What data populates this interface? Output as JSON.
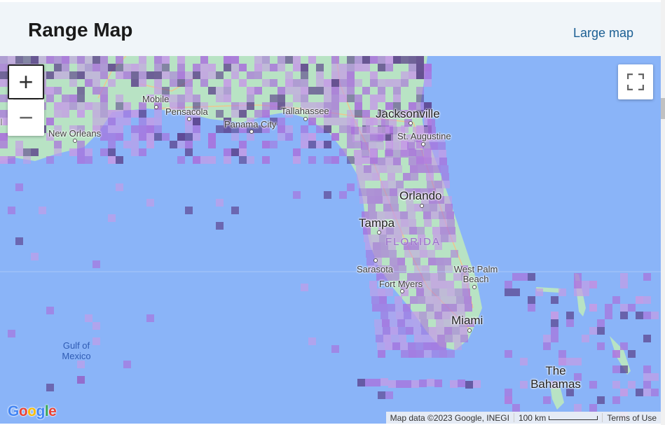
{
  "header": {
    "title": "Range Map",
    "large_map_label": "Large map"
  },
  "map": {
    "zoom_in_label": "+",
    "zoom_out_label": "−",
    "cities": [
      {
        "name": "Mobile",
        "size": "small"
      },
      {
        "name": "Pensacola",
        "size": "small"
      },
      {
        "name": "New Orleans",
        "size": "small"
      },
      {
        "name": "Panama City",
        "size": "small"
      },
      {
        "name": "Tallahassee",
        "size": "small"
      },
      {
        "name": "Jacksonville",
        "size": "big"
      },
      {
        "name": "St. Augustine",
        "size": "small"
      },
      {
        "name": "Orlando",
        "size": "big"
      },
      {
        "name": "Tampa",
        "size": "big"
      },
      {
        "name": "Sarasota",
        "size": "small"
      },
      {
        "name": "Fort Myers",
        "size": "small"
      },
      {
        "name": "West Palm Beach",
        "size": "small"
      },
      {
        "name": "Miami",
        "size": "big"
      },
      {
        "name": "The Bahamas",
        "size": "big"
      }
    ],
    "state_label": "FLORIDA",
    "water_label": "Gulf of Mexico",
    "left_edge_label": "I",
    "google_logo": "Google",
    "attribution": {
      "map_data": "Map data ©2023 Google, INEGI",
      "scale": "100 km",
      "terms": "Terms of Use"
    },
    "colors": {
      "water": "#8ab4f8",
      "land": "#b8e3c4",
      "range_light": "#c59be6",
      "range_mid": "#a970dc",
      "range_dark": "#5a3e8a"
    }
  }
}
